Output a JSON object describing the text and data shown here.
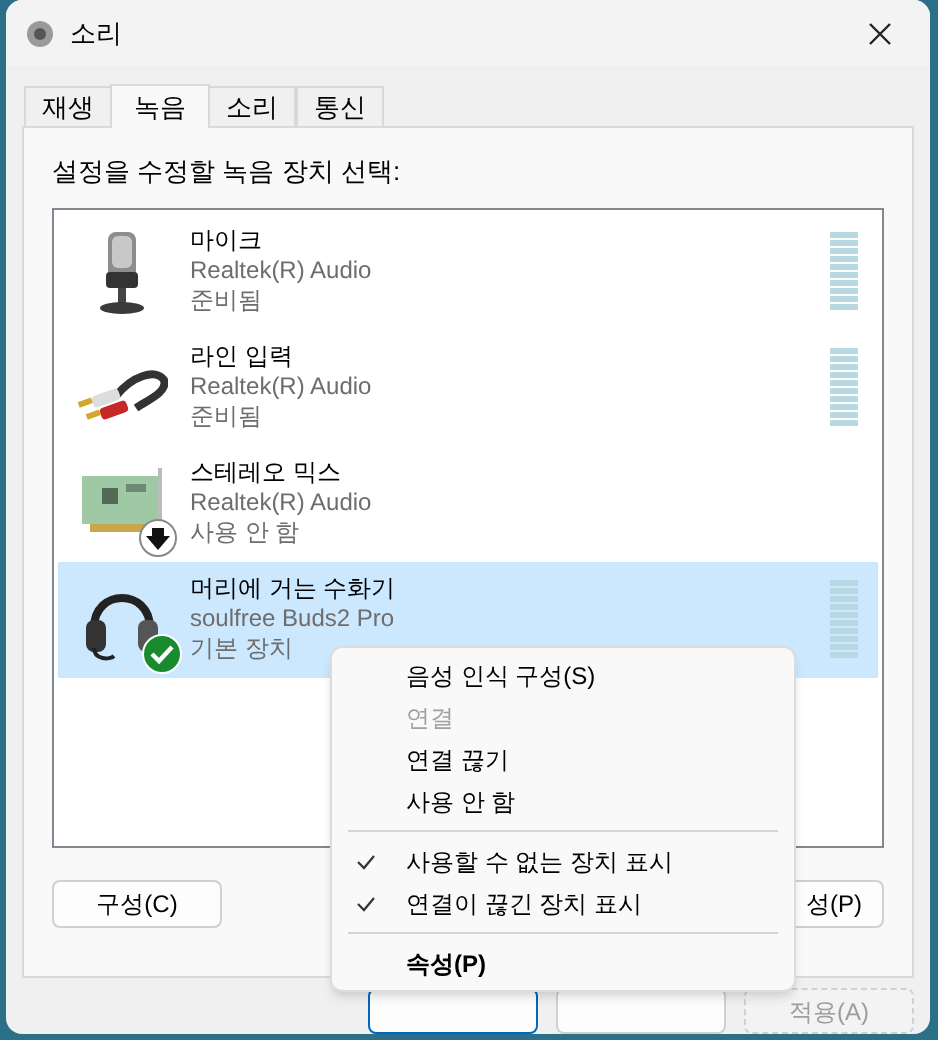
{
  "window": {
    "title": "소리"
  },
  "tabs": [
    {
      "label": "재생",
      "selected": false
    },
    {
      "label": "녹음",
      "selected": true
    },
    {
      "label": "소리",
      "selected": false
    },
    {
      "label": "통신",
      "selected": false
    }
  ],
  "instruction": "설정을 수정할 녹음 장치 선택:",
  "devices": [
    {
      "kind": "microphone",
      "name": "마이크",
      "driver": "Realtek(R) Audio",
      "status": "준비됨",
      "is_default": false,
      "disabled": false,
      "selected": false,
      "level": 0
    },
    {
      "kind": "line-in",
      "name": "라인 입력",
      "driver": "Realtek(R) Audio",
      "status": "준비됨",
      "is_default": false,
      "disabled": false,
      "selected": false,
      "level": 0
    },
    {
      "kind": "sound-card",
      "name": "스테레오 믹스",
      "driver": "Realtek(R) Audio",
      "status": "사용 안 함",
      "is_default": false,
      "disabled": true,
      "selected": false
    },
    {
      "kind": "headset",
      "name": "머리에 거는 수화기",
      "driver": "soulfree Buds2 Pro",
      "status": "기본 장치",
      "is_default": true,
      "disabled": false,
      "selected": true,
      "level": 0
    }
  ],
  "panel_buttons": [
    {
      "label": "구성(C)"
    },
    {
      "label": "성(P)"
    }
  ],
  "dialog_buttons": [
    {
      "default": true,
      "disabled": false
    },
    {
      "default": false,
      "disabled": false
    },
    {
      "label": "적용(A)",
      "default": false,
      "disabled": true
    }
  ],
  "context_menu": [
    {
      "kind": "item",
      "label": "음성 인식 구성(S)",
      "disabled": false,
      "checked": false,
      "bold": false
    },
    {
      "kind": "item",
      "label": "연결",
      "disabled": true,
      "checked": false,
      "bold": false
    },
    {
      "kind": "item",
      "label": "연결 끊기",
      "disabled": false,
      "checked": false,
      "bold": false
    },
    {
      "kind": "item",
      "label": "사용 안 함",
      "disabled": false,
      "checked": false,
      "bold": false
    },
    {
      "kind": "separator"
    },
    {
      "kind": "item",
      "label": "사용할 수 없는 장치 표시",
      "disabled": false,
      "checked": true,
      "bold": false
    },
    {
      "kind": "item",
      "label": "연결이 끊긴 장치 표시",
      "disabled": false,
      "checked": true,
      "bold": false
    },
    {
      "kind": "separator"
    },
    {
      "kind": "item",
      "label": "속성(P)",
      "disabled": false,
      "checked": false,
      "bold": true
    }
  ]
}
